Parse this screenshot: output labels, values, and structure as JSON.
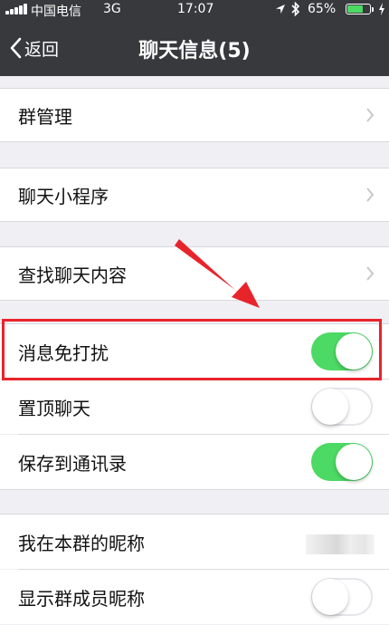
{
  "status_bar": {
    "carrier": "中国电信",
    "network": "3G",
    "time": "17:07",
    "battery": "65%",
    "battery_level": 0.65
  },
  "nav": {
    "back_label": "返回",
    "title": "聊天信息(5)"
  },
  "rows": {
    "group_manage": "群管理",
    "mini_programs": "聊天小程序",
    "search_content": "查找聊天内容",
    "mute": "消息免打扰",
    "pin_top": "置顶聊天",
    "save_contacts": "保存到通讯录",
    "my_nickname": "我在本群的昵称",
    "show_nicknames": "显示群成员昵称"
  },
  "toggles": {
    "mute": true,
    "pin_top": false,
    "save_contacts": true,
    "show_nicknames": false
  },
  "colors": {
    "accent_toggle": "#4cd964",
    "highlight_box": "#e8242b",
    "arrow": "#e8242b",
    "nav_bg": "#38393d"
  }
}
